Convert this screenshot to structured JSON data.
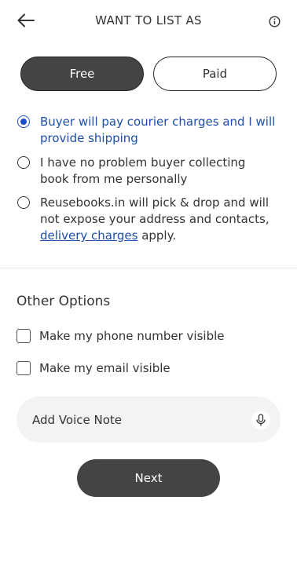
{
  "header": {
    "title": "WANT TO LIST AS",
    "back_icon": "arrow-left-icon",
    "info_icon": "info-icon"
  },
  "listing_type": {
    "options": [
      "Free",
      "Paid"
    ],
    "selected": "Free"
  },
  "shipping_options": [
    {
      "text": "Buyer will pay courier charges and I will provide shipping",
      "selected": true
    },
    {
      "text": "I have no problem buyer collecting book from me personally",
      "selected": false
    },
    {
      "text_before": "Reusebooks.in will pick & drop and will not expose your address  and contacts, ",
      "link": "delivery charges",
      "text_after": " apply.",
      "selected": false
    }
  ],
  "other_options": {
    "title": "Other Options",
    "items": [
      {
        "label": "Make my phone number visible",
        "checked": false
      },
      {
        "label": "Make my email visible",
        "checked": false
      }
    ]
  },
  "voice_note": {
    "label": "Add Voice Note",
    "icon": "microphone-icon"
  },
  "next_button": "Next",
  "colors": {
    "primary_dark": "#444444",
    "accent_blue": "#1d4ea8",
    "field_bg": "#f3f3f3"
  }
}
